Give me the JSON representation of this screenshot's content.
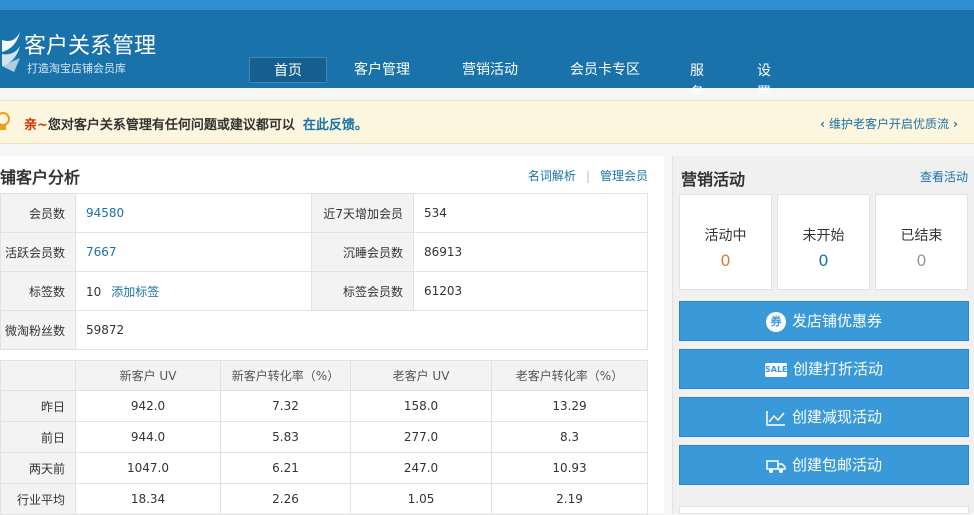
{
  "header": {
    "brand": "客户关系管理",
    "subtitle": "打造淘宝店铺会员库",
    "nav": [
      {
        "label": "首页",
        "active": true
      },
      {
        "label": "客户管理"
      },
      {
        "label": "营销活动"
      },
      {
        "label": "会员卡专区"
      },
      {
        "label": "服务"
      },
      {
        "label": "设置"
      }
    ]
  },
  "notice": {
    "prefix": "亲~",
    "text": "您对客户关系管理有任何问题或建议都可以",
    "link": "在此反馈。",
    "right_text": "维护老客户开启优质流"
  },
  "analysis": {
    "title": "铺客户分析",
    "links": [
      "名词解析",
      "管理会员"
    ],
    "stats": {
      "members_label": "会员数",
      "members_value": "94580",
      "new7_label": "近7天增加会员",
      "new7_value": "534",
      "active_label": "活跃会员数",
      "active_value": "7667",
      "sleep_label": "沉睡会员数",
      "sleep_value": "86913",
      "tags_label": "标签数",
      "tags_value": "10",
      "add_tag": "添加标签",
      "tagged_label": "标签会员数",
      "tagged_value": "61203",
      "weitao_label": "微淘粉丝数",
      "weitao_value": "59872"
    },
    "uv_table": {
      "headers": [
        "",
        "新客户 UV",
        "新客户转化率（%）",
        "老客户 UV",
        "老客户转化率（%）"
      ],
      "rows": [
        [
          "昨日",
          "942.0",
          "7.32",
          "158.0",
          "13.29"
        ],
        [
          "前日",
          "944.0",
          "5.83",
          "277.0",
          "8.3"
        ],
        [
          "两天前",
          "1047.0",
          "6.21",
          "247.0",
          "10.93"
        ],
        [
          "行业平均",
          "18.34",
          "2.26",
          "1.05",
          "2.19"
        ]
      ]
    }
  },
  "marketing": {
    "title": "营销活动",
    "view_link": "查看活动",
    "status": [
      {
        "label": "活动中",
        "value": "0",
        "color": "#e07b2f"
      },
      {
        "label": "未开始",
        "value": "0",
        "color": "#1a72aa"
      },
      {
        "label": "已结束",
        "value": "0",
        "color": "#999999"
      }
    ],
    "actions": [
      {
        "label": "发店铺优惠券",
        "icon": "券"
      },
      {
        "label": "创建打折活动",
        "icon": "SALE"
      },
      {
        "label": "创建减现活动"
      },
      {
        "label": "创建包邮活动"
      }
    ]
  }
}
